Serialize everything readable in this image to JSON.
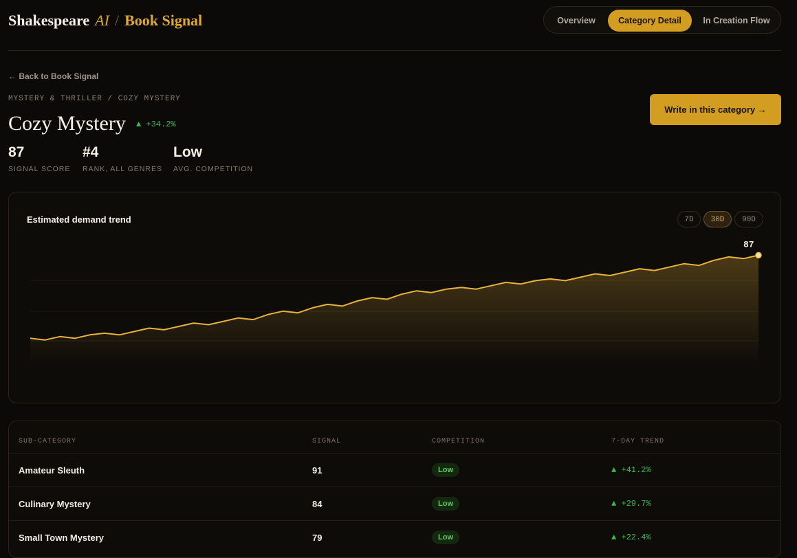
{
  "brand": {
    "name": "Shakespeare",
    "ai": "AI",
    "sep": "/",
    "product": "Book Signal"
  },
  "tabs": [
    {
      "label": "Overview",
      "active": false
    },
    {
      "label": "Category Detail",
      "active": true
    },
    {
      "label": "In Creation Flow",
      "active": false
    }
  ],
  "back_label": "← Back to Book Signal",
  "breadcrumb": "MYSTERY & THRILLER / COZY MYSTERY",
  "category_title": "Cozy Mystery",
  "growth": "▲ +34.2%",
  "cta_label": "Write in this category →",
  "stats": [
    {
      "value": "87",
      "label": "SIGNAL SCORE"
    },
    {
      "value": "#4",
      "label": "RANK, ALL GENRES"
    },
    {
      "value": "Low",
      "label": "AVG. COMPETITION"
    }
  ],
  "chart_card": {
    "title": "Estimated demand trend",
    "ranges": [
      {
        "label": "7D",
        "active": false
      },
      {
        "label": "30D",
        "active": true
      },
      {
        "label": "90D",
        "active": false
      }
    ]
  },
  "chart_data": {
    "type": "area",
    "title": "Estimated demand trend",
    "x": [
      1,
      2,
      3,
      4,
      5,
      6,
      7,
      8,
      9,
      10,
      11,
      12,
      13,
      14,
      15,
      16,
      17,
      18,
      19,
      20,
      21,
      22,
      23,
      24,
      25,
      26,
      27,
      28,
      29,
      30
    ],
    "values": [
      38,
      37,
      39,
      38,
      40,
      41,
      40,
      42,
      44,
      43,
      45,
      47,
      46,
      48,
      50,
      49,
      52,
      54,
      53,
      56,
      58,
      57,
      60,
      62,
      61,
      64,
      66,
      65,
      67,
      68,
      67,
      69,
      71,
      70,
      72,
      73,
      72,
      74,
      76,
      75,
      77,
      79,
      78,
      80,
      82,
      81,
      84,
      86,
      85,
      87
    ],
    "last_label": "87",
    "color": "#e8b13a"
  },
  "table": {
    "headers": [
      "SUB-CATEGORY",
      "SIGNAL",
      "COMPETITION",
      "7-DAY TREND"
    ],
    "rows": [
      {
        "name": "Amateur Sleuth",
        "signal": "91",
        "competition": "Low",
        "trend": "▲ +41.2%"
      },
      {
        "name": "Culinary Mystery",
        "signal": "84",
        "competition": "Low",
        "trend": "▲ +29.7%"
      },
      {
        "name": "Small Town Mystery",
        "signal": "79",
        "competition": "Low",
        "trend": "▲ +22.4%"
      }
    ]
  }
}
